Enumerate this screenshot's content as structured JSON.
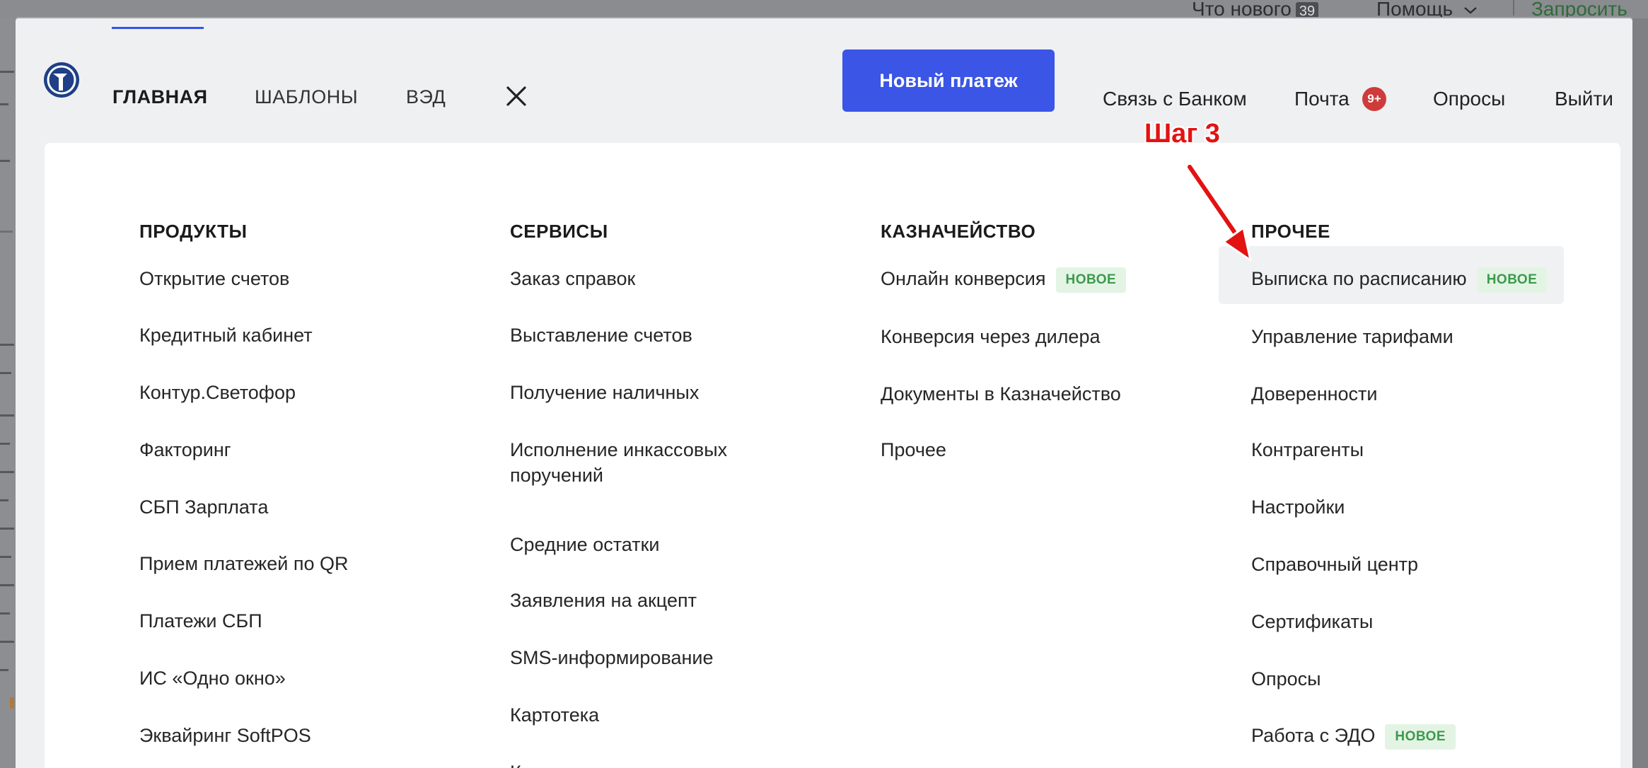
{
  "background": {
    "whats_new_label": "Что нового",
    "whats_new_count": "39",
    "help_label": "Помощь",
    "request_label": "Запросить"
  },
  "nav": {
    "tabs": [
      {
        "label": "ГЛАВНАЯ",
        "active": true
      },
      {
        "label": "ШАБЛОНЫ",
        "active": false
      },
      {
        "label": "ВЭД",
        "active": false
      }
    ],
    "close_icon": "close-icon",
    "new_payment_label": "Новый платеж",
    "bank_link": "Связь с Банком",
    "mail_link": "Почта",
    "mail_badge": "9+",
    "polls_link": "Опросы",
    "logout_link": "Выйти"
  },
  "menu": {
    "new_badge": "НОВОЕ",
    "columns": [
      {
        "heading": "ПРОДУКТЫ",
        "items": [
          "Открытие счетов",
          "Кредитный кабинет",
          "Контур.Светофор",
          "Факторинг",
          "СБП Зарплата",
          "Прием платежей по QR",
          "Платежи СБП",
          "ИС «Одно окно»",
          "Эквайринг SoftPOS"
        ]
      },
      {
        "heading": "СЕРВИСЫ",
        "items": [
          "Заказ справок",
          "Выставление счетов",
          "Получение наличных",
          "Исполнение инкассовых поручений",
          "Средние остатки",
          "Заявления на акцепт",
          "SMS-информирование",
          "Картотека",
          "Комплаенс-ассистент"
        ]
      },
      {
        "heading": "КАЗНАЧЕЙСТВО",
        "items": [
          "Онлайн конверсия",
          "Конверсия через дилера",
          "Документы в Казначейство",
          "Прочее"
        ]
      },
      {
        "heading": "ПРОЧЕЕ",
        "items": [
          "Выписка по расписанию",
          "Управление тарифами",
          "Доверенности",
          "Контрагенты",
          "Настройки",
          "Справочный центр",
          "Сертификаты",
          "Опросы",
          "Работа с ЭДО"
        ]
      }
    ]
  },
  "annotation": {
    "step_label": "Шаг 3",
    "color": "#e31212"
  },
  "colors": {
    "accent": "#3b55e6",
    "badge_green_bg": "#e3f4e5",
    "badge_green_text": "#3d9a4c",
    "mail_badge": "#cf3a3a"
  }
}
